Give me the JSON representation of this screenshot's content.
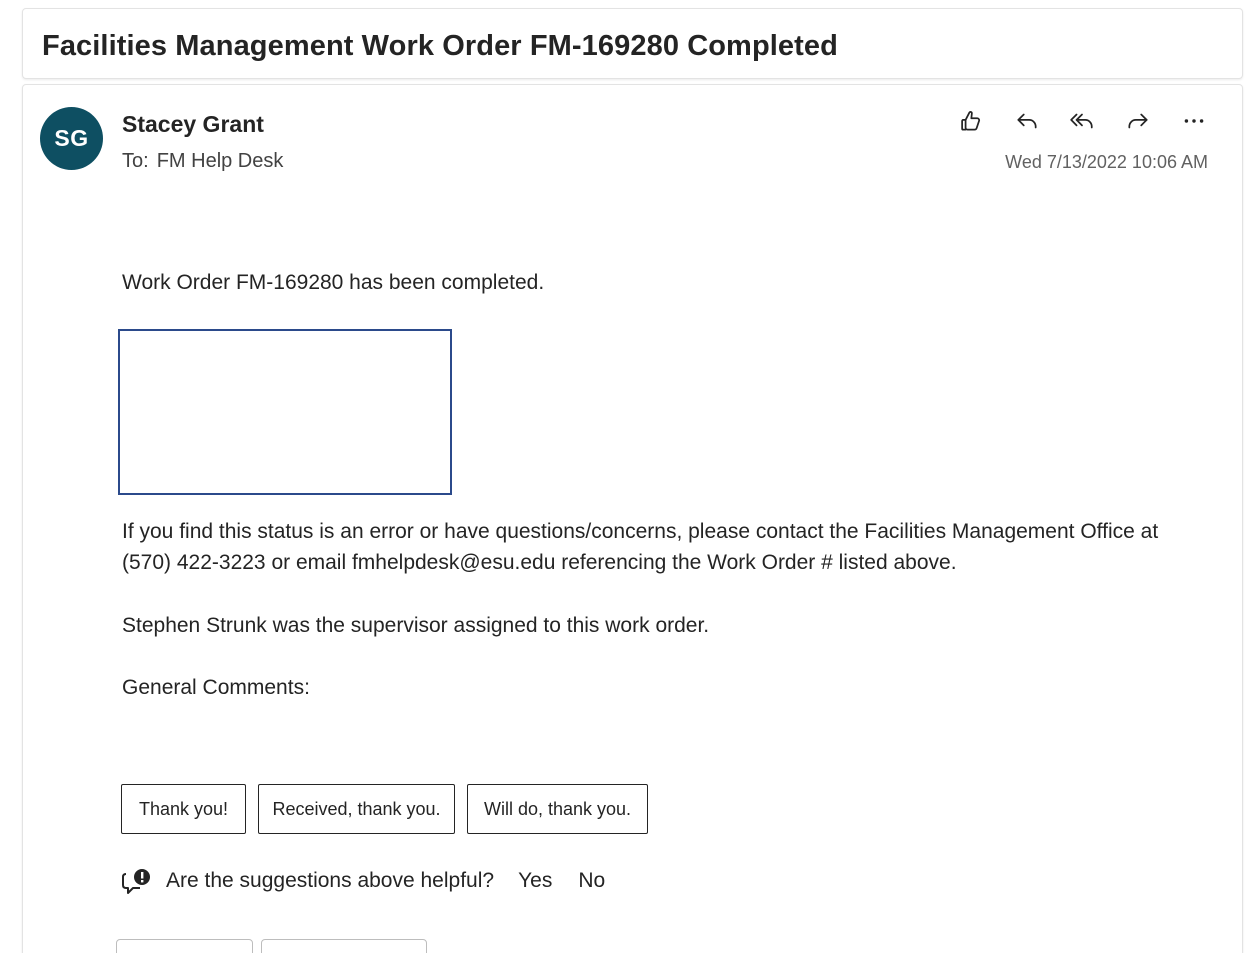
{
  "email": {
    "subject": "Facilities Management Work Order FM-169280 Completed",
    "sender": {
      "initials": "SG",
      "name": "Stacey Grant",
      "avatar_color": "#0e4f62"
    },
    "to_label": "To:",
    "to_value": "FM Help Desk",
    "timestamp": "Wed 7/13/2022 10:06 AM",
    "actions": [
      {
        "name": "like",
        "icon": "thumbs-up-icon"
      },
      {
        "name": "reply",
        "icon": "reply-icon"
      },
      {
        "name": "reply-all",
        "icon": "reply-all-icon"
      },
      {
        "name": "forward",
        "icon": "forward-icon"
      },
      {
        "name": "more",
        "icon": "more-actions-icon"
      }
    ],
    "body": {
      "line1": "Work Order FM-169280 has been completed.",
      "line2": "If you find this status is an error or have questions/concerns, please contact the Facilities Management Office at (570) 422-3223 or email fmhelpdesk@esu.edu referencing the Work Order # listed above.",
      "line3": "Stephen Strunk was the supervisor assigned to this work order.",
      "line4": "General Comments:"
    },
    "suggested_replies": [
      "Thank you!",
      "Received, thank you.",
      "Will do, thank you."
    ],
    "feedback": {
      "question": "Are the suggestions above helpful?",
      "yes": "Yes",
      "no": "No"
    },
    "colors": {
      "image_border": "#2b4a8b"
    }
  }
}
